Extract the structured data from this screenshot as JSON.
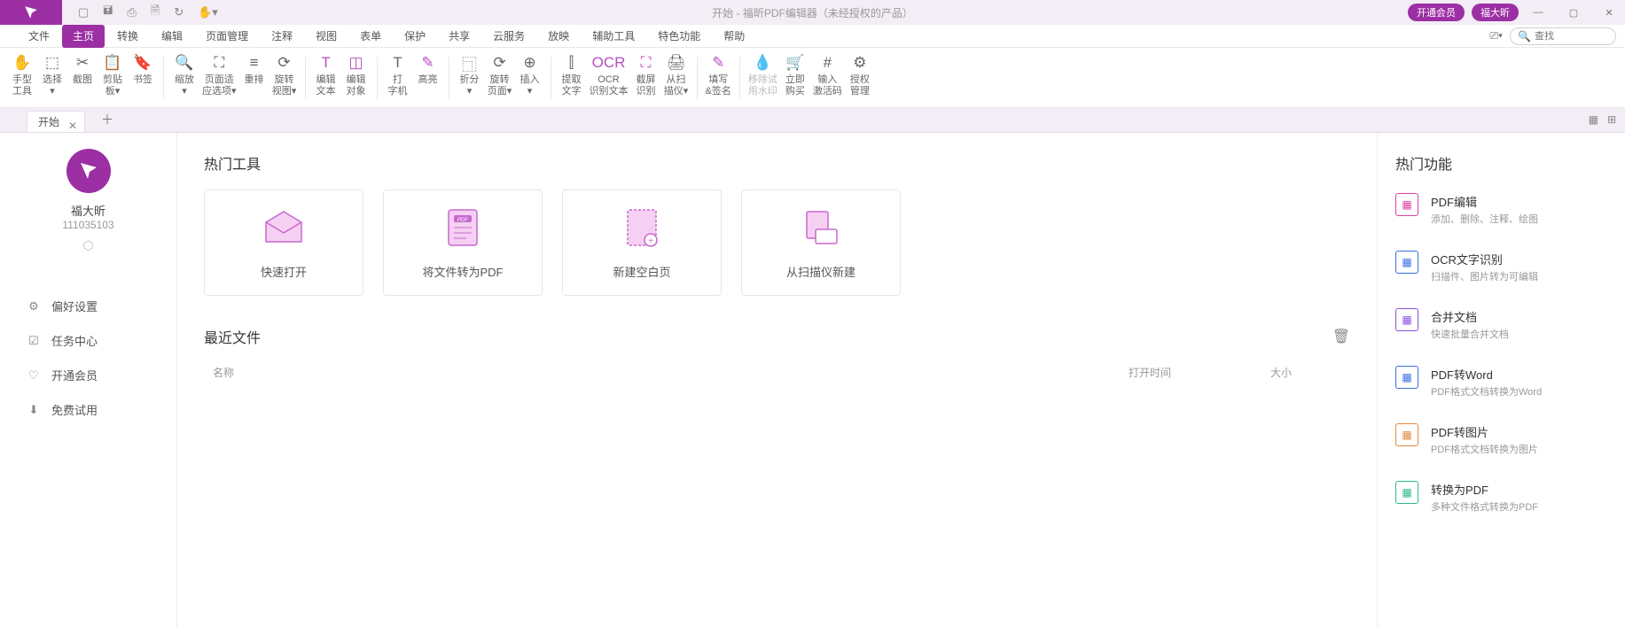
{
  "titlebar": {
    "title": "开始 - 福昕PDF编辑器（未经授权的产品）",
    "vip_label": "开通会员",
    "user_label": "福大昕"
  },
  "menu": [
    "文件",
    "主页",
    "转换",
    "编辑",
    "页面管理",
    "注释",
    "视图",
    "表单",
    "保护",
    "共享",
    "云服务",
    "放映",
    "辅助工具",
    "特色功能",
    "帮助"
  ],
  "menu_active_index": 1,
  "search_placeholder": "查找",
  "ribbon": [
    {
      "label": "手型\n工具"
    },
    {
      "label": "选择\n▾"
    },
    {
      "label": "截图"
    },
    {
      "label": "剪贴\n板▾"
    },
    {
      "label": "书签"
    },
    {
      "sep": true
    },
    {
      "label": "缩放\n▾"
    },
    {
      "label": "页面适\n应选项▾"
    },
    {
      "label": "重排"
    },
    {
      "label": "旋转\n视图▾"
    },
    {
      "sep": true
    },
    {
      "label": "编辑\n文本",
      "accent": true
    },
    {
      "label": "编辑\n对象",
      "accent": true
    },
    {
      "sep": true
    },
    {
      "label": "打\n字机"
    },
    {
      "label": "高亮",
      "accent": true
    },
    {
      "sep": true
    },
    {
      "label": "折分\n▾"
    },
    {
      "label": "旋转\n页面▾"
    },
    {
      "label": "插入\n▾"
    },
    {
      "sep": true
    },
    {
      "label": "提取\n文字"
    },
    {
      "label": "OCR\n识别文本",
      "accent": true
    },
    {
      "label": "截屏\n识别",
      "accent": true
    },
    {
      "label": "从扫\n描仪▾"
    },
    {
      "sep": true
    },
    {
      "label": "填写\n&签名",
      "accent": true
    },
    {
      "sep": true
    },
    {
      "label": "移除试\n用水印",
      "disabled": true
    },
    {
      "label": "立即\n购买"
    },
    {
      "label": "输入\n激活码"
    },
    {
      "label": "授权\n管理"
    }
  ],
  "tab_label": "开始",
  "user": {
    "name": "福大昕",
    "id": "111035103"
  },
  "left_nav": [
    {
      "icon": "⚙",
      "label": "偏好设置"
    },
    {
      "icon": "☑",
      "label": "任务中心"
    },
    {
      "icon": "♡",
      "label": "开通会员"
    },
    {
      "icon": "⬇",
      "label": "免费试用"
    }
  ],
  "hot_tools_title": "热门工具",
  "tool_cards": [
    {
      "label": "快速打开"
    },
    {
      "label": "将文件转为PDF"
    },
    {
      "label": "新建空白页"
    },
    {
      "label": "从扫描仪新建"
    }
  ],
  "recent_title": "最近文件",
  "recent_cols": {
    "name": "名称",
    "time": "打开时间",
    "size": "大小"
  },
  "hot_features_title": "热门功能",
  "features": [
    {
      "title": "PDF编辑",
      "desc": "添加、删除、注释、绘图",
      "color": "#e23ea3"
    },
    {
      "title": "OCR文字识别",
      "desc": "扫描件、图片转为可编辑",
      "color": "#3d6fe2"
    },
    {
      "title": "合并文档",
      "desc": "快速批量合并文档",
      "color": "#8b4fe2"
    },
    {
      "title": "PDF转Word",
      "desc": "PDF格式文档转换为Word",
      "color": "#3d6fe2"
    },
    {
      "title": "PDF转图片",
      "desc": "PDF格式文档转换为图片",
      "color": "#e28a3d"
    },
    {
      "title": "转换为PDF",
      "desc": "多种文件格式转换为PDF",
      "color": "#2fb88a"
    }
  ]
}
